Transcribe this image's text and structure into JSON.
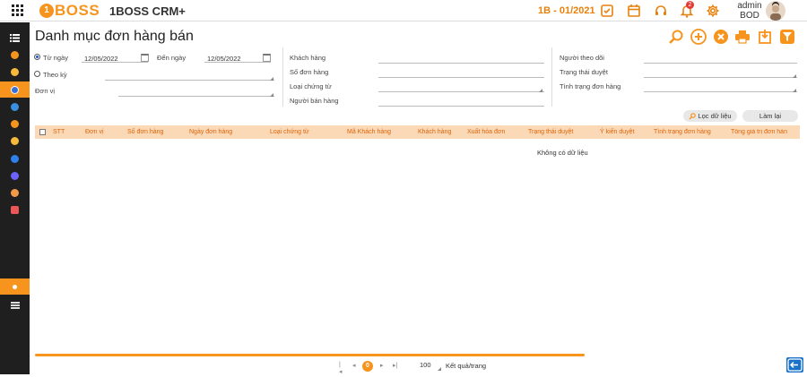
{
  "header": {
    "logo_mark": "1",
    "logo_text": "BOSS",
    "app_name": "1BOSS CRM+",
    "period": "1B - 01/2021",
    "notification_count": "2",
    "user_name": "admin",
    "user_role": "BOD"
  },
  "page": {
    "title": "Danh mục đơn hàng bán"
  },
  "filters": {
    "from_date_label": "Từ ngày",
    "from_date_value": "12/05/2022",
    "to_date_label": "Đến ngày",
    "to_date_value": "12/05/2022",
    "by_period_label": "Theo kỳ",
    "unit_label": "Đơn vị",
    "customer_label": "Khách hàng",
    "order_no_label": "Số đơn hàng",
    "doc_type_label": "Loại chứng từ",
    "salesperson_label": "Người bán hàng",
    "follower_label": "Người theo dõi",
    "approval_status_label": "Trạng thái duyệt",
    "order_status_label": "Tình trạng đơn hàng",
    "filter_button": "Lọc dữ liệu",
    "reset_button": "Làm lại"
  },
  "table": {
    "columns": [
      "STT",
      "Đơn vị",
      "Số đơn hàng",
      "Ngày đơn hàng",
      "Loại chứng từ",
      "Mã Khách hàng",
      "Khách hàng",
      "Xuất hóa đơn",
      "Trạng thái duyệt",
      "Ý kiến duyệt",
      "Tình trạng đơn hàng",
      "Tổng giá trị đơn hàn"
    ],
    "empty_text": "Không có dữ liệu"
  },
  "pager": {
    "current_page": "0",
    "page_size": "100",
    "page_size_label": "Kết quả/trang"
  },
  "colors": {
    "accent": "#f7941d",
    "sidebar": "#1f1f1f",
    "table_header_bg": "#fcd9b6",
    "table_header_text": "#d9650b"
  }
}
